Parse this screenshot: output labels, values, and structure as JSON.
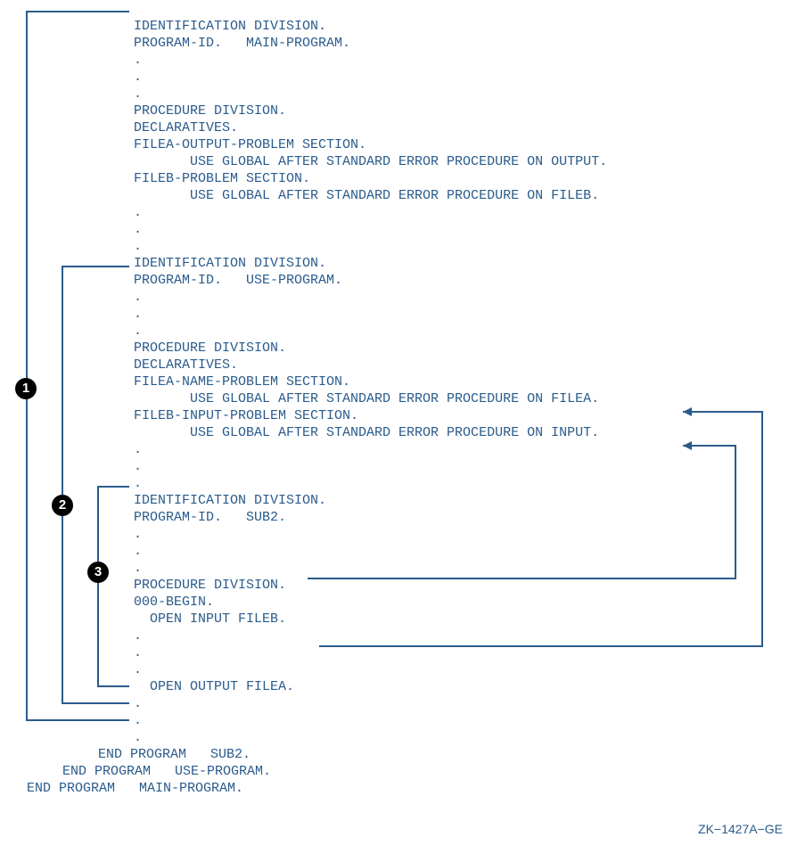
{
  "p1": {
    "l1": "IDENTIFICATION DIVISION.",
    "l2": "PROGRAM-ID.   MAIN-PROGRAM.",
    "l3": "PROCEDURE DIVISION.",
    "l4": "DECLARATIVES.",
    "l5": "FILEA-OUTPUT-PROBLEM SECTION.",
    "l6": "       USE GLOBAL AFTER STANDARD ERROR PROCEDURE ON OUTPUT.",
    "l7": "FILEB-PROBLEM SECTION.",
    "l8": "       USE GLOBAL AFTER STANDARD ERROR PROCEDURE ON FILEB."
  },
  "p2": {
    "l1": "IDENTIFICATION DIVISION.",
    "l2": "PROGRAM-ID.   USE-PROGRAM.",
    "l3": "PROCEDURE DIVISION.",
    "l4": "DECLARATIVES.",
    "l5": "FILEA-NAME-PROBLEM SECTION.",
    "l6": "       USE GLOBAL AFTER STANDARD ERROR PROCEDURE ON FILEA.",
    "l7": "FILEB-INPUT-PROBLEM SECTION.",
    "l8": "       USE GLOBAL AFTER STANDARD ERROR PROCEDURE ON INPUT."
  },
  "p3": {
    "l1": "IDENTIFICATION DIVISION.",
    "l2": "PROGRAM-ID.   SUB2.",
    "l3": "PROCEDURE DIVISION.",
    "l4": "000-BEGIN.",
    "l5": "  OPEN INPUT FILEB.",
    "l6": "  OPEN OUTPUT FILEA."
  },
  "end": {
    "e1": "END PROGRAM   SUB2.",
    "e2": "END PROGRAM   USE-PROGRAM.",
    "e3": "END PROGRAM   MAIN-PROGRAM."
  },
  "dots3": ".\n.\n.",
  "footer": "ZK−1427A−GE",
  "badges": {
    "b1": "1",
    "b2": "2",
    "b3": "3"
  }
}
